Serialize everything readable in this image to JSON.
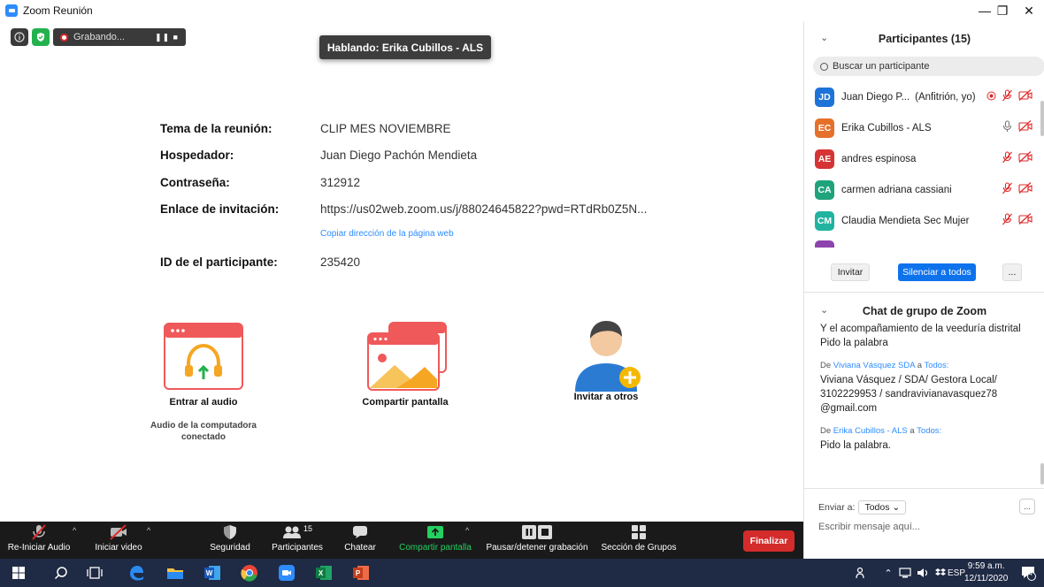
{
  "window": {
    "title": "Zoom Reunión",
    "minimize": "—",
    "restore": "❐",
    "close": "✕"
  },
  "topbar": {
    "recording_label": "Grabando...",
    "recording_controls": "❚❚ ■"
  },
  "speaking": "Hablando: Erika Cubillos - ALS",
  "meeting_info": {
    "topic_label": "Tema de la reunión:",
    "topic_value": "CLIP MES NOVIEMBRE",
    "host_label": "Hospedador:",
    "host_value": "Juan Diego Pachón Mendieta",
    "password_label": "Contraseña:",
    "password_value": "312912",
    "invite_label": "Enlace de invitación:",
    "invite_value": "https://us02web.zoom.us/j/88024645822?pwd=RTdRb0Z5N...",
    "copy_link": "Copiar dirección de la página web",
    "participant_id_label": "ID de el participante:",
    "participant_id_value": "235420"
  },
  "actions": {
    "join_audio": "Entrar al audio",
    "audio_status": "Audio de la computadora conectado",
    "share_screen": "Compartir pantalla",
    "invite_others": "Invitar a otros"
  },
  "participants_panel": {
    "title": "Participantes (15)",
    "search_placeholder": "Buscar un participante",
    "participants": [
      {
        "initials": "JD",
        "name": "Juan Diego P...",
        "role": "(Anfitrión, yo)",
        "color": "#1e73d8"
      },
      {
        "initials": "EC",
        "name": "Erika Cubillos - ALS",
        "role": "",
        "color": "#e5702a"
      },
      {
        "initials": "AE",
        "name": "andres espinosa",
        "role": "",
        "color": "#d63434"
      },
      {
        "initials": "CA",
        "name": "carmen adriana cassiani",
        "role": "",
        "color": "#1fa37a"
      },
      {
        "initials": "CM",
        "name": "Claudia Mendieta Sec Mujer",
        "role": "",
        "color": "#21b3a0"
      }
    ],
    "invite_button": "Invitar",
    "mute_all_button": "Silenciar a todos",
    "more_button": "..."
  },
  "chat_panel": {
    "title": "Chat de grupo de Zoom",
    "messages": [
      {
        "lines": "Y el acompañamiento de la veeduría distrital"
      },
      {
        "lines": "Pido la palabra"
      },
      {
        "from_prefix": "De",
        "from": "Viviana Vásquez SDA",
        "to_prefix": "a",
        "to": "Todos:",
        "lines": "Viviana Vásquez / SDA/ Gestora Local/ 3102229953 / sandravivianavasquez78 @gmail.com"
      },
      {
        "from_prefix": "De",
        "from": "Erika Cubillos - ALS",
        "to_prefix": "a",
        "to": "Todos:",
        "lines": "Pido la palabra."
      }
    ],
    "send_to_label": "Enviar a:",
    "send_to_value": "Todos ⌄",
    "input_placeholder": "Escribir mensaje aquí...",
    "more": "..."
  },
  "toolbar": {
    "audio": "Re-Iniciar Audio",
    "video": "Iniciar video",
    "security": "Seguridad",
    "participants": "Participantes",
    "participants_count": "15",
    "chat": "Chatear",
    "share": "Compartir pantalla",
    "record": "Pausar/detener grabación",
    "breakout": "Sección de Grupos",
    "end": "Finalizar",
    "accent_green": "#23d160",
    "end_color": "#d42b2b"
  },
  "taskbar": {
    "lang": "ESP",
    "time": "9:59 a.m.",
    "date": "12/11/2020",
    "notifications": "4"
  }
}
